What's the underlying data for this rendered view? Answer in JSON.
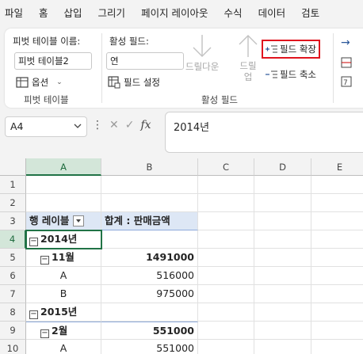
{
  "menu": {
    "tabs": [
      "파일",
      "홈",
      "삽입",
      "그리기",
      "페이지 레이아웃",
      "수식",
      "데이터",
      "검토"
    ]
  },
  "ribbon": {
    "pivot_name_label": "피벗 테이블 이름:",
    "pivot_name_value": "피벗 테이블2",
    "options_label": "옵션",
    "group_pivot_table": "피벗 테이블",
    "active_field_label": "활성 필드:",
    "active_field_value": "연",
    "field_settings_label": "필드 설정",
    "drill_down_label": "드릴다운",
    "drill_up_label": "드릴\n업",
    "expand_field_label": "필드 확장",
    "collapse_field_label": "필드 축소",
    "group_active_field": "활성 필드"
  },
  "formula_bar": {
    "name_box": "A4",
    "formula": "2014년"
  },
  "grid": {
    "columns": [
      "A",
      "B",
      "C",
      "D",
      "E"
    ],
    "rows": [
      "1",
      "2",
      "3",
      "4",
      "5",
      "6",
      "7",
      "8",
      "9",
      "10"
    ],
    "pivot": {
      "header_row_label": "행 레이블",
      "header_value_label": "합계 : 판매금액",
      "rows": [
        {
          "label": "2014년",
          "value": ""
        },
        {
          "label": "11월",
          "value": "1491000"
        },
        {
          "label": "A",
          "value": "516000"
        },
        {
          "label": "B",
          "value": "975000"
        },
        {
          "label": "2015년",
          "value": ""
        },
        {
          "label": "2월",
          "value": "551000"
        },
        {
          "label": "A",
          "value": "551000"
        }
      ]
    }
  },
  "colors": {
    "accent": "#217346",
    "highlight": "#e0141e",
    "pivot_header": "#dde7f5"
  }
}
